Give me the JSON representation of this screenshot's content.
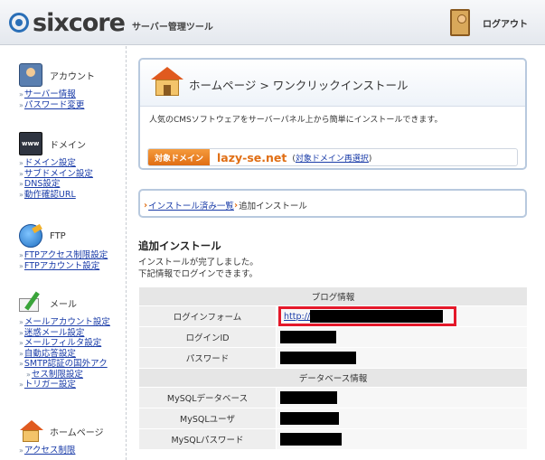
{
  "header": {
    "logo_text": "sixcore",
    "subtitle": "サーバー管理ツール",
    "logout_label": "ログアウト"
  },
  "sidebar": {
    "sections": [
      {
        "title": "アカウント",
        "icon": "account-icon",
        "links": [
          "サーバー情報",
          "パスワード変更"
        ]
      },
      {
        "title": "ドメイン",
        "icon": "www-domain-icon",
        "links": [
          "ドメイン設定",
          "サブドメイン設定",
          "DNS設定",
          "動作確認URL"
        ]
      },
      {
        "title": "FTP",
        "icon": "globe-ftp-icon",
        "links": [
          "FTPアクセス制限設定",
          "FTPアカウント設定"
        ]
      },
      {
        "title": "メール",
        "icon": "mail-icon",
        "links": [
          "メールアカウント設定",
          "迷惑メール設定",
          "メールフィルタ設定",
          "自動応答設定",
          "SMTP認証の国外アク",
          "セス制限設定",
          "トリガー設定"
        ]
      },
      {
        "title": "ホームページ",
        "icon": "home-icon",
        "links": [
          "アクセス制限"
        ]
      }
    ]
  },
  "main": {
    "page_title": "ホームページ > ワンクリックインストール",
    "description": "人気のCMSソフトウェアをサーバーパネル上から簡単にインストールできます。",
    "domain_badge": "対象ドメイン",
    "domain_name": "lazy-se.net",
    "domain_paren_open": "(",
    "domain_reselect": "対象ドメイン再選択",
    "domain_paren_close": ")",
    "breadcrumb": {
      "link": "インストール済み一覧",
      "current": "追加インストール"
    },
    "section_title": "追加インストール",
    "message_line1": "インストールが完了しました。",
    "message_line2": "下記情報でログインできます。",
    "blog_group": "ブログ情報",
    "login_form_label": "ログインフォーム",
    "login_form_url": "http://",
    "login_id_label": "ログインID",
    "password_label": "パスワード",
    "db_group": "データベース情報",
    "mysql_db_label": "MySQLデータベース",
    "mysql_user_label": "MySQLユーザ",
    "mysql_password_label": "MySQLパスワード"
  },
  "colors": {
    "accent_orange": "#e06e14",
    "link_blue": "#1a3ca8",
    "highlight_red": "#e4182a"
  }
}
